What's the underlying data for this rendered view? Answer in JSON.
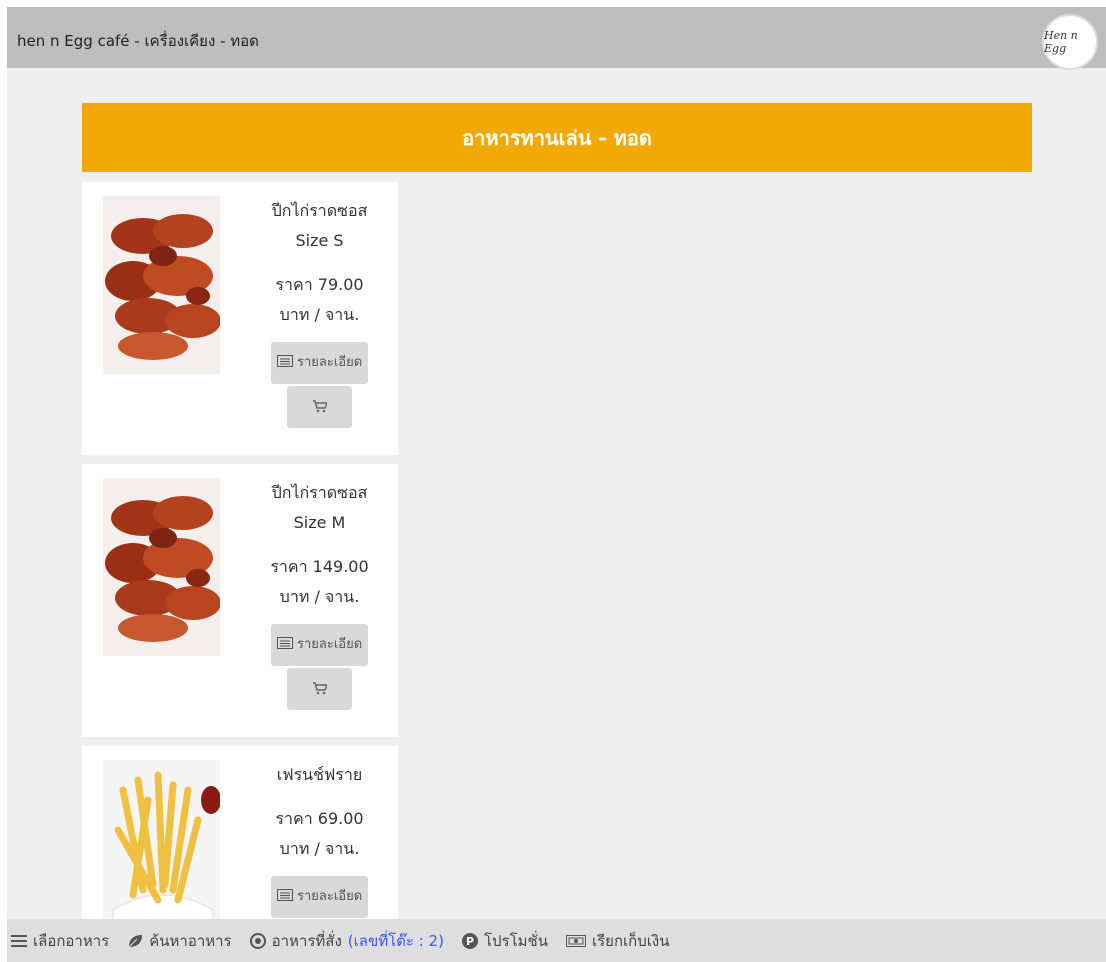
{
  "header": {
    "title": "hen n Egg café - เครื่องเคียง - ทอด",
    "logo_text": "Hen n Egg"
  },
  "category": {
    "title": "อาหารทานเล่น - ทอด"
  },
  "items": [
    {
      "name_line1": "ปีกไก่ราดซอส",
      "name_line2": "Size S",
      "price_line1": "ราคา 79.00",
      "price_line2": "บาท / จาน.",
      "detail_label": "รายละเอียด"
    },
    {
      "name_line1": "ปีกไก่ราดซอส",
      "name_line2": "Size M",
      "price_line1": "ราคา 149.00",
      "price_line2": "บาท / จาน.",
      "detail_label": "รายละเอียด"
    },
    {
      "name_line1": "เฟรนช์ฟราย",
      "price_line1": "ราคา 69.00",
      "price_line2": "บาท / จาน.",
      "detail_label": "รายละเอียด"
    }
  ],
  "bottom_nav": {
    "menu": "เลือกอาหาร",
    "search": "ค้นหาอาหาร",
    "orders": "อาหารที่สั่ง",
    "table_info": "(เลขที่โต๊ะ : 2)",
    "promotion": "โปรโมชั่น",
    "checkout": "เรียกเก็บเงิน"
  },
  "colors": {
    "accent": "#f2a906",
    "table_link": "#3a57ff",
    "topbar": "#bdbdbd"
  }
}
